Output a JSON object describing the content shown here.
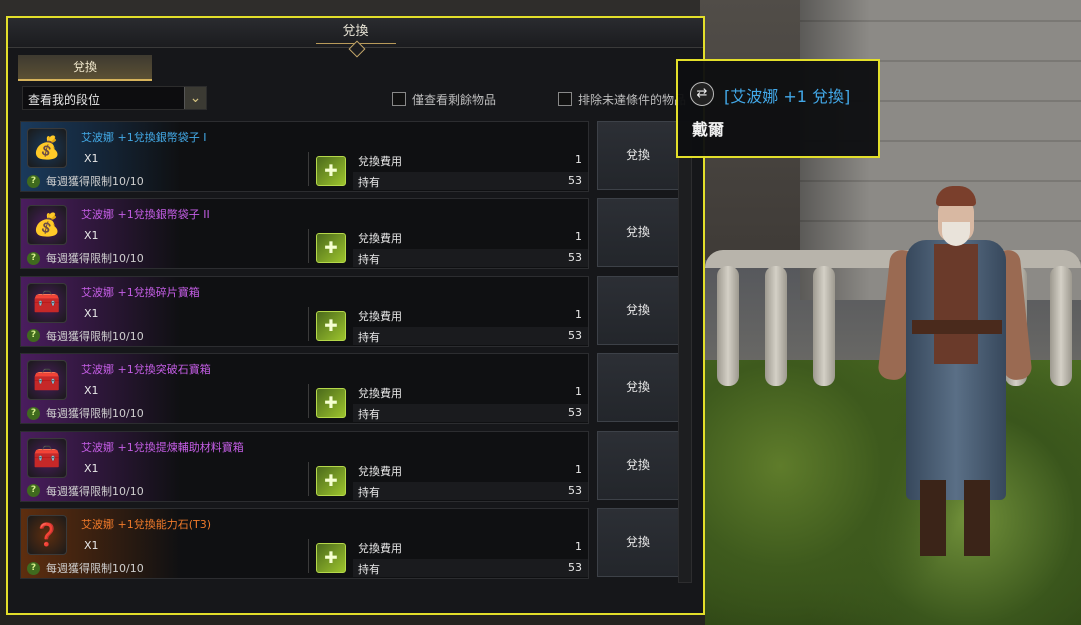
{
  "window": {
    "title": "兌換"
  },
  "tabs": [
    {
      "label": "兌換"
    }
  ],
  "filters": {
    "dropdown_value": "查看我的段位",
    "only_remaining_label": "僅查看剩餘物品",
    "exclude_unmet_label": "排除未達條件的物品"
  },
  "items": [
    {
      "name": "艾波娜 +1兌換銀幣袋子 I",
      "name_color": "#43a9e6",
      "glow": "#1a3a5c",
      "icon": "💰",
      "icon_name": "silver-pouch-icon",
      "qty": "X1",
      "limit": "每週獲得限制10/10",
      "cost_label": "兌換費用",
      "cost": "1",
      "own_label": "持有",
      "own": "53",
      "button": "兌換"
    },
    {
      "name": "艾波娜 +1兌換銀幣袋子 II",
      "name_color": "#c55ee6",
      "glow": "#4a1d5e",
      "icon": "💰",
      "icon_name": "silver-pouch-icon",
      "qty": "X1",
      "limit": "每週獲得限制10/10",
      "cost_label": "兌換費用",
      "cost": "1",
      "own_label": "持有",
      "own": "53",
      "button": "兌換"
    },
    {
      "name": "艾波娜 +1兌換碎片寶箱",
      "name_color": "#c55ee6",
      "glow": "#4a1d5e",
      "icon": "🧰",
      "icon_name": "shard-chest-icon",
      "qty": "X1",
      "limit": "每週獲得限制10/10",
      "cost_label": "兌換費用",
      "cost": "1",
      "own_label": "持有",
      "own": "53",
      "button": "兌換"
    },
    {
      "name": "艾波娜 +1兌換突破石寶箱",
      "name_color": "#c55ee6",
      "glow": "#4a1d5e",
      "icon": "🧰",
      "icon_name": "breakthrough-stone-chest-icon",
      "qty": "X1",
      "limit": "每週獲得限制10/10",
      "cost_label": "兌換費用",
      "cost": "1",
      "own_label": "持有",
      "own": "53",
      "button": "兌換"
    },
    {
      "name": "艾波娜 +1兌換提煉輔助材料寶箱",
      "name_color": "#c55ee6",
      "glow": "#4a1d5e",
      "icon": "🧰",
      "icon_name": "refining-material-chest-icon",
      "qty": "X1",
      "limit": "每週獲得限制10/10",
      "cost_label": "兌換費用",
      "cost": "1",
      "own_label": "持有",
      "own": "53",
      "button": "兌換"
    },
    {
      "name": "艾波娜 +1兌換能力石(T3)",
      "name_color": "#f07a2a",
      "glow": "#5e2e0f",
      "icon": "❓",
      "icon_name": "ability-stone-icon",
      "qty": "X1",
      "limit": "每週獲得限制10/10",
      "cost_label": "兌換費用",
      "cost": "1",
      "own_label": "持有",
      "own": "53",
      "button": "兌換"
    }
  ],
  "tooltip": {
    "title": "[艾波娜 +1 兌換]",
    "npc_name": "戴爾"
  },
  "colors": {
    "highlight_border": "#e3df2a",
    "legendary_name": "#f07a2a",
    "epic_name": "#c55ee6",
    "rare_name": "#43a9e6"
  }
}
